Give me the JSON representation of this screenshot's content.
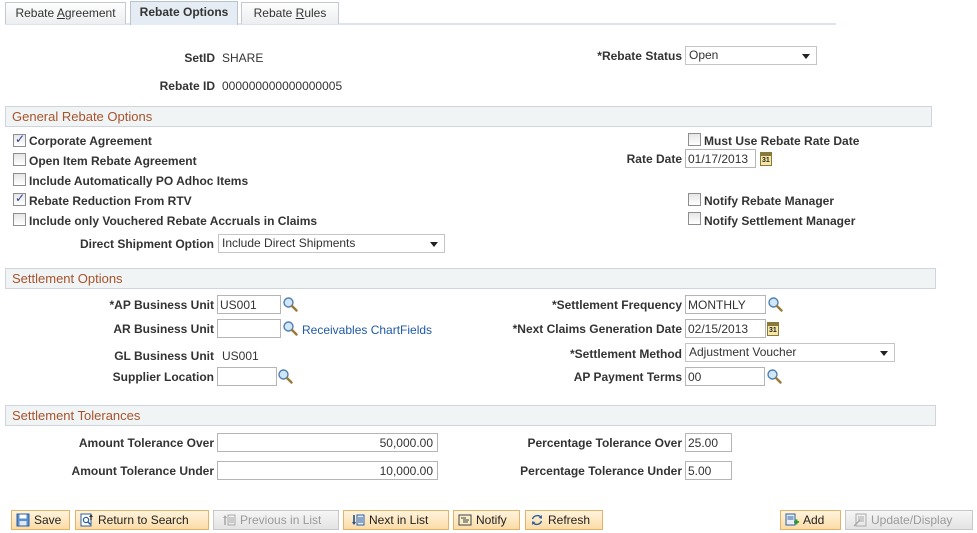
{
  "tabs": [
    {
      "label_pre": "Rebate ",
      "label_accel": "A",
      "label_post": "greement",
      "active": false
    },
    {
      "label_pre": "Rebate Options",
      "label_accel": "",
      "label_post": "",
      "active": true
    },
    {
      "label_pre": "Rebate ",
      "label_accel": "R",
      "label_post": "ules",
      "active": false
    }
  ],
  "header": {
    "setid_label": "SetID",
    "setid_value": "SHARE",
    "rebate_id_label": "Rebate ID",
    "rebate_id_value": "000000000000000005",
    "rebate_status_label": "*Rebate Status",
    "rebate_status_value": "Open"
  },
  "general": {
    "title": "General Rebate Options",
    "checkboxes_left": [
      {
        "label": "Corporate Agreement",
        "checked": true
      },
      {
        "label": "Open Item Rebate Agreement",
        "checked": false
      },
      {
        "label": "Include Automatically PO Adhoc Items",
        "checked": false
      },
      {
        "label": "Rebate Reduction From RTV",
        "checked": true
      },
      {
        "label": "Include only Vouchered Rebate Accruals in Claims",
        "checked": false
      }
    ],
    "must_use_rate_date": {
      "label": "Must Use Rebate Rate Date",
      "checked": false
    },
    "rate_date_label": "Rate Date",
    "rate_date_value": "01/17/2013",
    "notify_rebate_manager": {
      "label": "Notify Rebate Manager",
      "checked": false
    },
    "notify_settlement_manager": {
      "label": "Notify Settlement Manager",
      "checked": false
    },
    "direct_shipment_label": "Direct Shipment Option",
    "direct_shipment_value": "Include Direct Shipments"
  },
  "settlement": {
    "title": "Settlement Options",
    "ap_bu_label": "*AP Business Unit",
    "ap_bu_value": "US001",
    "ar_bu_label": "AR Business Unit",
    "ar_bu_value": "",
    "receivables_link": "Receivables ChartFields",
    "gl_bu_label": "GL Business Unit",
    "gl_bu_value": "US001",
    "supplier_location_label": "Supplier Location",
    "supplier_location_value": "",
    "frequency_label": "*Settlement Frequency",
    "frequency_value": "MONTHLY",
    "next_claims_label": "*Next Claims Generation Date",
    "next_claims_value": "02/15/2013",
    "method_label": "*Settlement Method",
    "method_value": "Adjustment Voucher",
    "ap_terms_label": "AP Payment Terms",
    "ap_terms_value": "00"
  },
  "tolerances": {
    "title": "Settlement Tolerances",
    "amt_over_label": "Amount Tolerance Over",
    "amt_over_value": "50,000.00",
    "amt_under_label": "Amount Tolerance Under",
    "amt_under_value": "10,000.00",
    "pct_over_label": "Percentage Tolerance Over",
    "pct_over_value": "25.00",
    "pct_under_label": "Percentage Tolerance Under",
    "pct_under_value": "5.00"
  },
  "calendar_icon_text": "31",
  "toolbar": {
    "save": "Save",
    "return_to_search": "Return to Search",
    "previous_in_list": "Previous in List",
    "next_in_list": "Next in List",
    "notify": "Notify",
    "refresh": "Refresh",
    "add": "Add",
    "update_display": "Update/Display"
  },
  "colors": {
    "section_title": "#a6532b",
    "link": "#1f59a6",
    "button_border": "#e3b36a"
  }
}
